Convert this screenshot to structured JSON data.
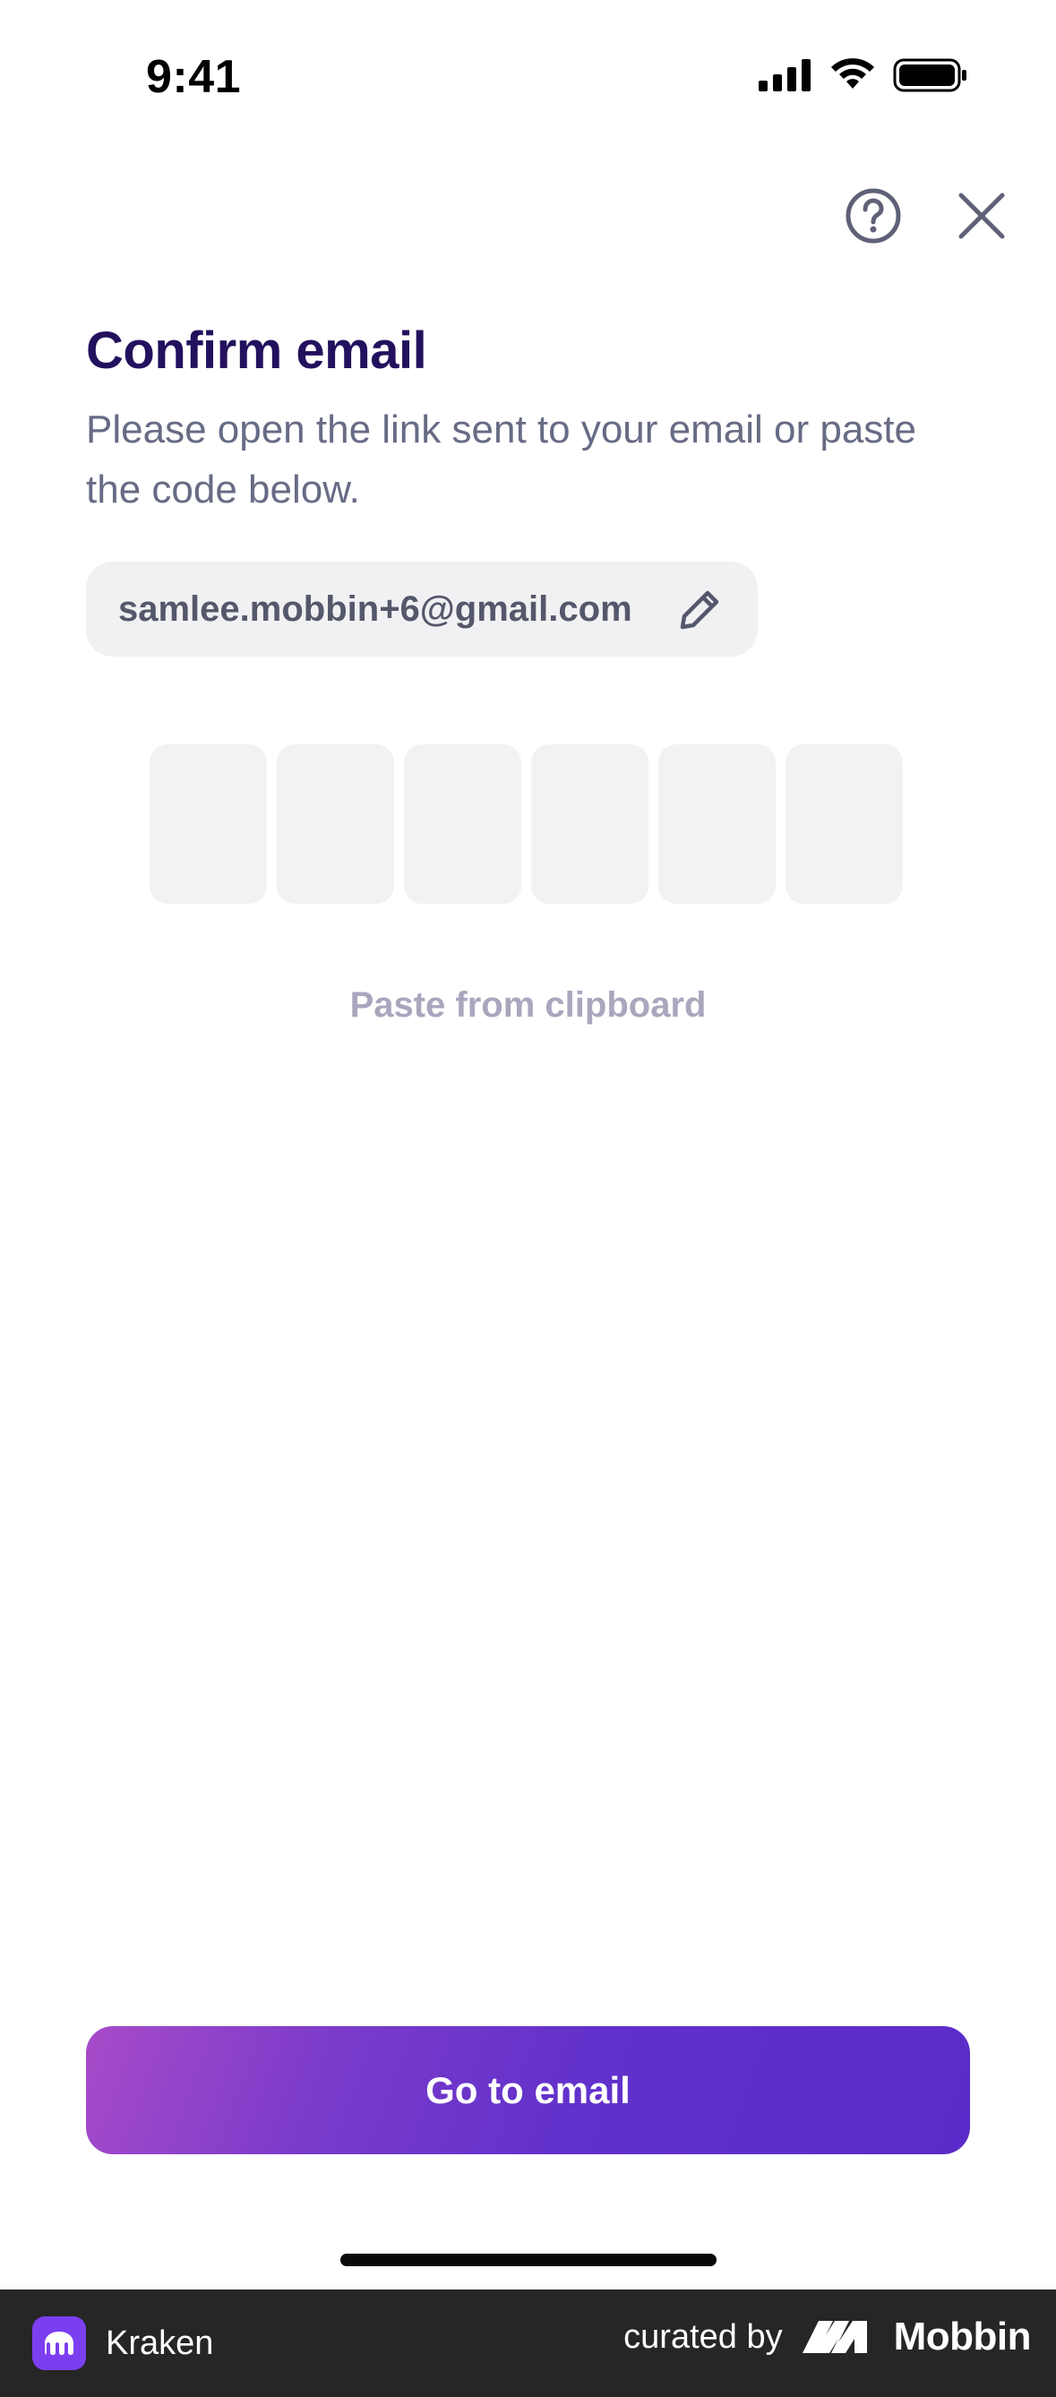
{
  "status_bar": {
    "time": "9:41"
  },
  "header": {
    "help_icon": "question-circle-icon",
    "close_icon": "close-icon"
  },
  "main": {
    "title": "Confirm email",
    "subtitle": "Please open the link sent to your email or paste the code below.",
    "email": "samlee.mobbin+6@gmail.com",
    "edit_icon": "pencil-icon",
    "code_boxes": [
      "",
      "",
      "",
      "",
      "",
      ""
    ],
    "paste_label": "Paste from clipboard",
    "primary_button": "Go to email"
  },
  "footer": {
    "app_name": "Kraken",
    "curated_label": "curated by",
    "brand": "Mobbin"
  },
  "colors": {
    "title": "#23115e",
    "subtitle": "#676b84",
    "accent_start": "#a74bc9",
    "accent_end": "#5a2bc8",
    "paste_link": "#aaa6bd",
    "footer_bg": "#262626"
  }
}
